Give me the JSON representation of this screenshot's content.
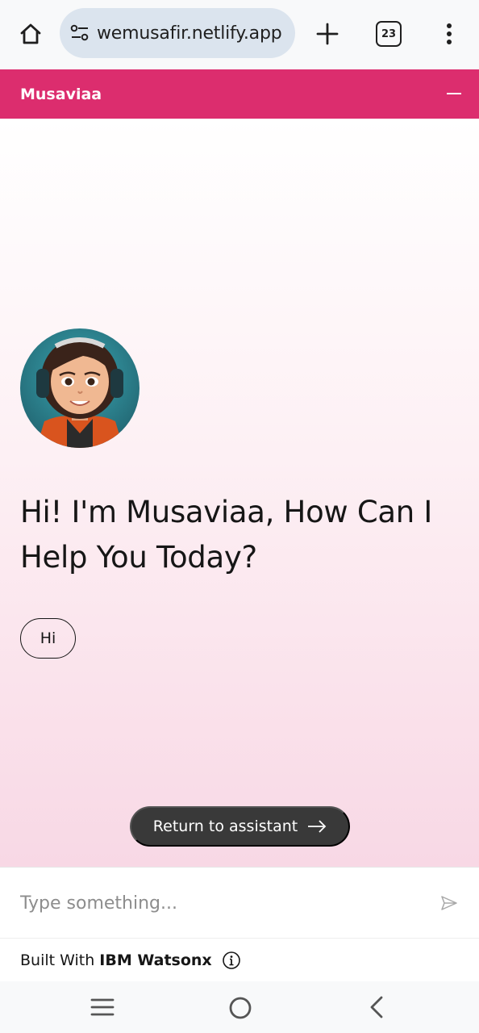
{
  "browser": {
    "url": "wemusafir.netlify.app",
    "tab_count": "23",
    "icons": [
      "home-icon",
      "site-settings-icon",
      "plus-icon",
      "tabs-icon",
      "more-vert-icon"
    ]
  },
  "header": {
    "title": "Musaviaa",
    "background": "#dc2d6e"
  },
  "chat": {
    "greeting": "Hi! I'm Musaviaa, How Can I Help You Today?",
    "chip_label": "Hi",
    "return_label": "Return to assistant"
  },
  "input": {
    "placeholder": "Type something..."
  },
  "footer": {
    "built_with": "Built With",
    "brand": "IBM Watsonx"
  },
  "nav": {
    "icons": [
      "recent-apps-icon",
      "home-circle-icon",
      "back-icon"
    ]
  }
}
